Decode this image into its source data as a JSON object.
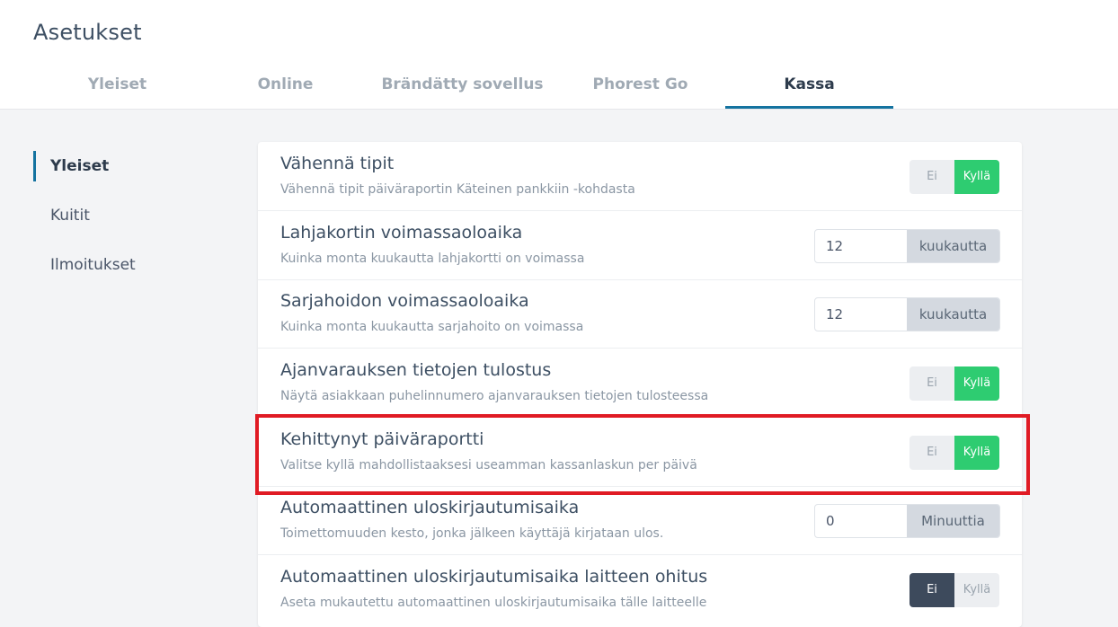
{
  "page": {
    "title": "Asetukset"
  },
  "tabs": [
    {
      "label": "Yleiset",
      "active": false
    },
    {
      "label": "Online",
      "active": false
    },
    {
      "label": "Brändätty sovellus",
      "active": false
    },
    {
      "label": "Phorest Go",
      "active": false
    },
    {
      "label": "Kassa",
      "active": true
    }
  ],
  "sidebar": {
    "items": [
      {
        "label": "Yleiset",
        "active": true
      },
      {
        "label": "Kuitit",
        "active": false
      },
      {
        "label": "Ilmoitukset",
        "active": false
      }
    ]
  },
  "settings": [
    {
      "title": "Vähennä tipit",
      "description": "Vähennä tipit päiväraportin Käteinen pankkiin -kohdasta",
      "control": "toggle",
      "no_label": "Ei",
      "yes_label": "Kyllä",
      "selected": "yes"
    },
    {
      "title": "Lahjakortin voimassaoloaika",
      "description": "Kuinka monta kuukautta lahjakortti on voimassa",
      "control": "number",
      "value": "12",
      "unit": "kuukautta"
    },
    {
      "title": "Sarjahoidon voimassaoloaika",
      "description": "Kuinka monta kuukautta sarjahoito on voimassa",
      "control": "number",
      "value": "12",
      "unit": "kuukautta"
    },
    {
      "title": "Ajanvarauksen tietojen tulostus",
      "description": "Näytä asiakkaan puhelinnumero ajanvarauksen tietojen tulosteessa",
      "control": "toggle",
      "no_label": "Ei",
      "yes_label": "Kyllä",
      "selected": "yes"
    },
    {
      "title": "Kehittynyt päiväraportti",
      "description": "Valitse kyllä mahdollistaaksesi useamman kassanlaskun per päivä",
      "control": "toggle",
      "no_label": "Ei",
      "yes_label": "Kyllä",
      "selected": "yes",
      "highlighted": true
    },
    {
      "title": "Automaattinen uloskirjautumisaika",
      "description": "Toimettomuuden kesto, jonka jälkeen käyttäjä kirjataan ulos.",
      "control": "number",
      "value": "0",
      "unit": "Minuuttia"
    },
    {
      "title": "Automaattinen uloskirjautumisaika laitteen ohitus",
      "description": "Aseta mukautettu automaattinen uloskirjautumisaika tälle laitteelle",
      "control": "toggle",
      "no_label": "Ei",
      "yes_label": "Kyllä",
      "selected": "no"
    }
  ],
  "colors": {
    "accent": "#1473a0",
    "toggle_yes": "#2ecc71",
    "toggle_no_selected": "#3d4a5c",
    "highlight": "#e01b24"
  }
}
